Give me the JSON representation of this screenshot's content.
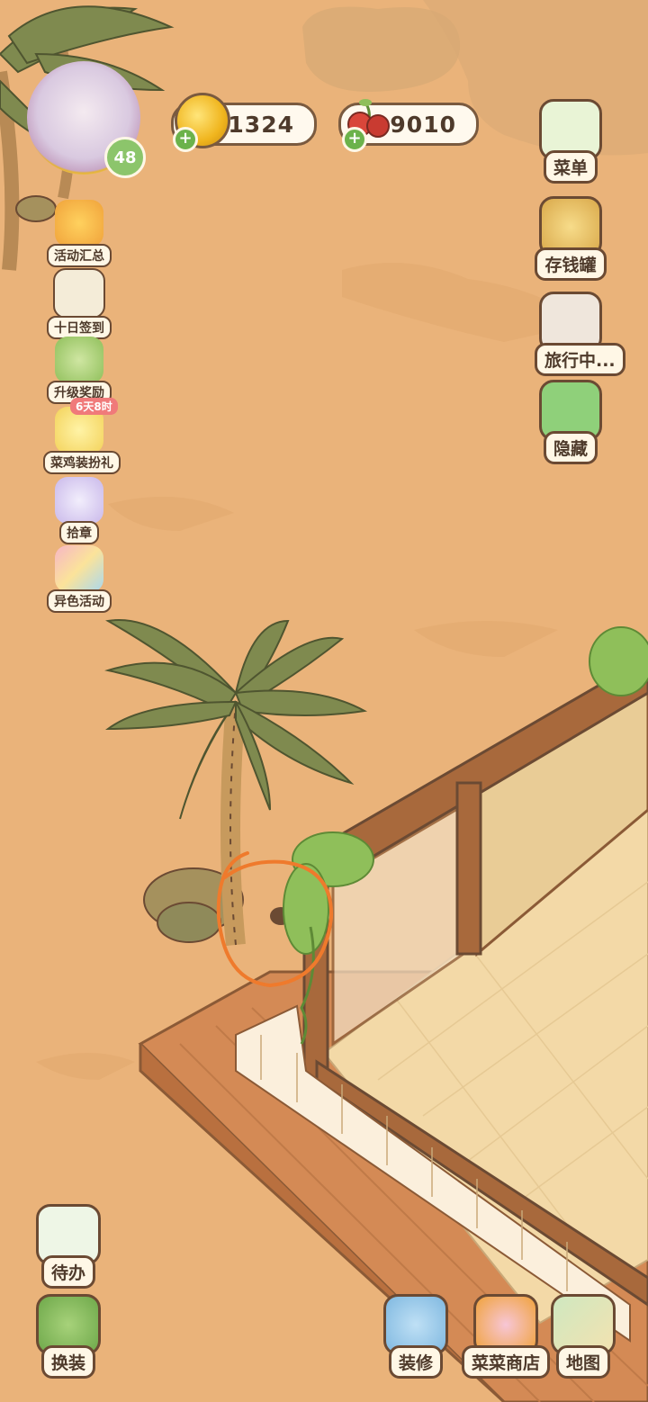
{
  "currencies": {
    "coins": "1324",
    "fruit": "9010"
  },
  "player": {
    "level": "48"
  },
  "left_menu": [
    {
      "label": "活动汇总",
      "icon": "event-summary-icon"
    },
    {
      "label": "十日签到",
      "icon": "ten-day-checkin-icon"
    },
    {
      "label": "升级奖励",
      "icon": "level-up-reward-icon"
    },
    {
      "label": "菜鸡装扮礼",
      "icon": "chick-dressup-gift-icon",
      "badge": "6天8时"
    },
    {
      "label": "拾章",
      "icon": "stamp-collect-icon"
    },
    {
      "label": "异色活动",
      "icon": "variant-event-icon"
    }
  ],
  "right_menu": [
    {
      "label": "菜单",
      "icon": "menu-list-icon"
    },
    {
      "label": "存钱罐",
      "icon": "piggy-bank-icon"
    },
    {
      "label": "旅行中...",
      "icon": "camera-travel-icon"
    },
    {
      "label": "隐藏",
      "icon": "hide-ui-icon"
    }
  ],
  "bottom_left": [
    {
      "label": "待办",
      "icon": "todo-list-icon"
    },
    {
      "label": "换装",
      "icon": "outfit-change-icon"
    }
  ],
  "bottom_right": [
    {
      "label": "装修",
      "icon": "decorate-icon"
    },
    {
      "label": "菜菜商店",
      "icon": "shop-icon"
    },
    {
      "label": "地图",
      "icon": "map-icon"
    }
  ],
  "colors": {
    "sand": "#eab37a",
    "deck": "#d48a55",
    "floor": "#f3d9a7",
    "wall": "#e9cc96",
    "outline": "#6b4a33",
    "annotation": "#ef7a2c"
  }
}
